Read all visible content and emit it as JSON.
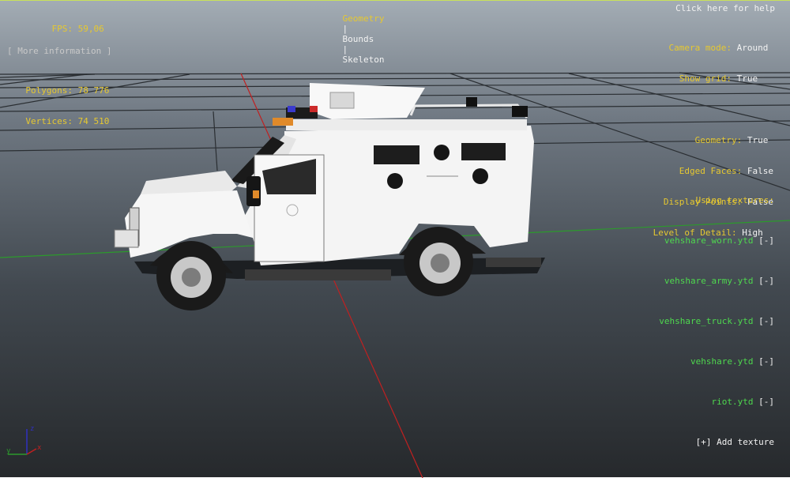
{
  "tabs": {
    "geometry": "Geometry",
    "separator": "|",
    "bounds": "Bounds",
    "skeleton": "Skeleton"
  },
  "help": "Click here for help",
  "stats": {
    "fps_label": "FPS:",
    "fps_value": "59,06",
    "polygons_label": "Polygons:",
    "polygons_value": "78 776",
    "vertices_label": "Vertices:",
    "vertices_value": "74 510"
  },
  "more_info": "[ More information ]",
  "settings": {
    "camera_mode_label": "Camera mode:",
    "camera_mode_value": "Around",
    "show_grid_label": "Show grid:",
    "show_grid_value": "True",
    "geometry_label": "Geometry:",
    "geometry_value": "True",
    "edged_faces_label": "Edged Faces:",
    "edged_faces_value": "False",
    "display_points_label": "Display Points:",
    "display_points_value": "False",
    "lod_label": "Level of Detail:",
    "lod_value": "High"
  },
  "textures": {
    "header": "Using textures:",
    "remove": "[-]",
    "items": [
      "vehshare_worn.ytd",
      "vehshare_army.ytd",
      "vehshare_truck.ytd",
      "vehshare.ytd",
      "riot.ytd"
    ],
    "add": "[+] Add texture"
  },
  "axes": {
    "x": "x",
    "y": "y",
    "z": "z"
  },
  "colors": {
    "hud_yellow": "#e6c830",
    "hud_green": "#4ed84e",
    "axis_red": "#c02020",
    "axis_green": "#2c9a2c",
    "axis_blue": "#3030c0"
  }
}
